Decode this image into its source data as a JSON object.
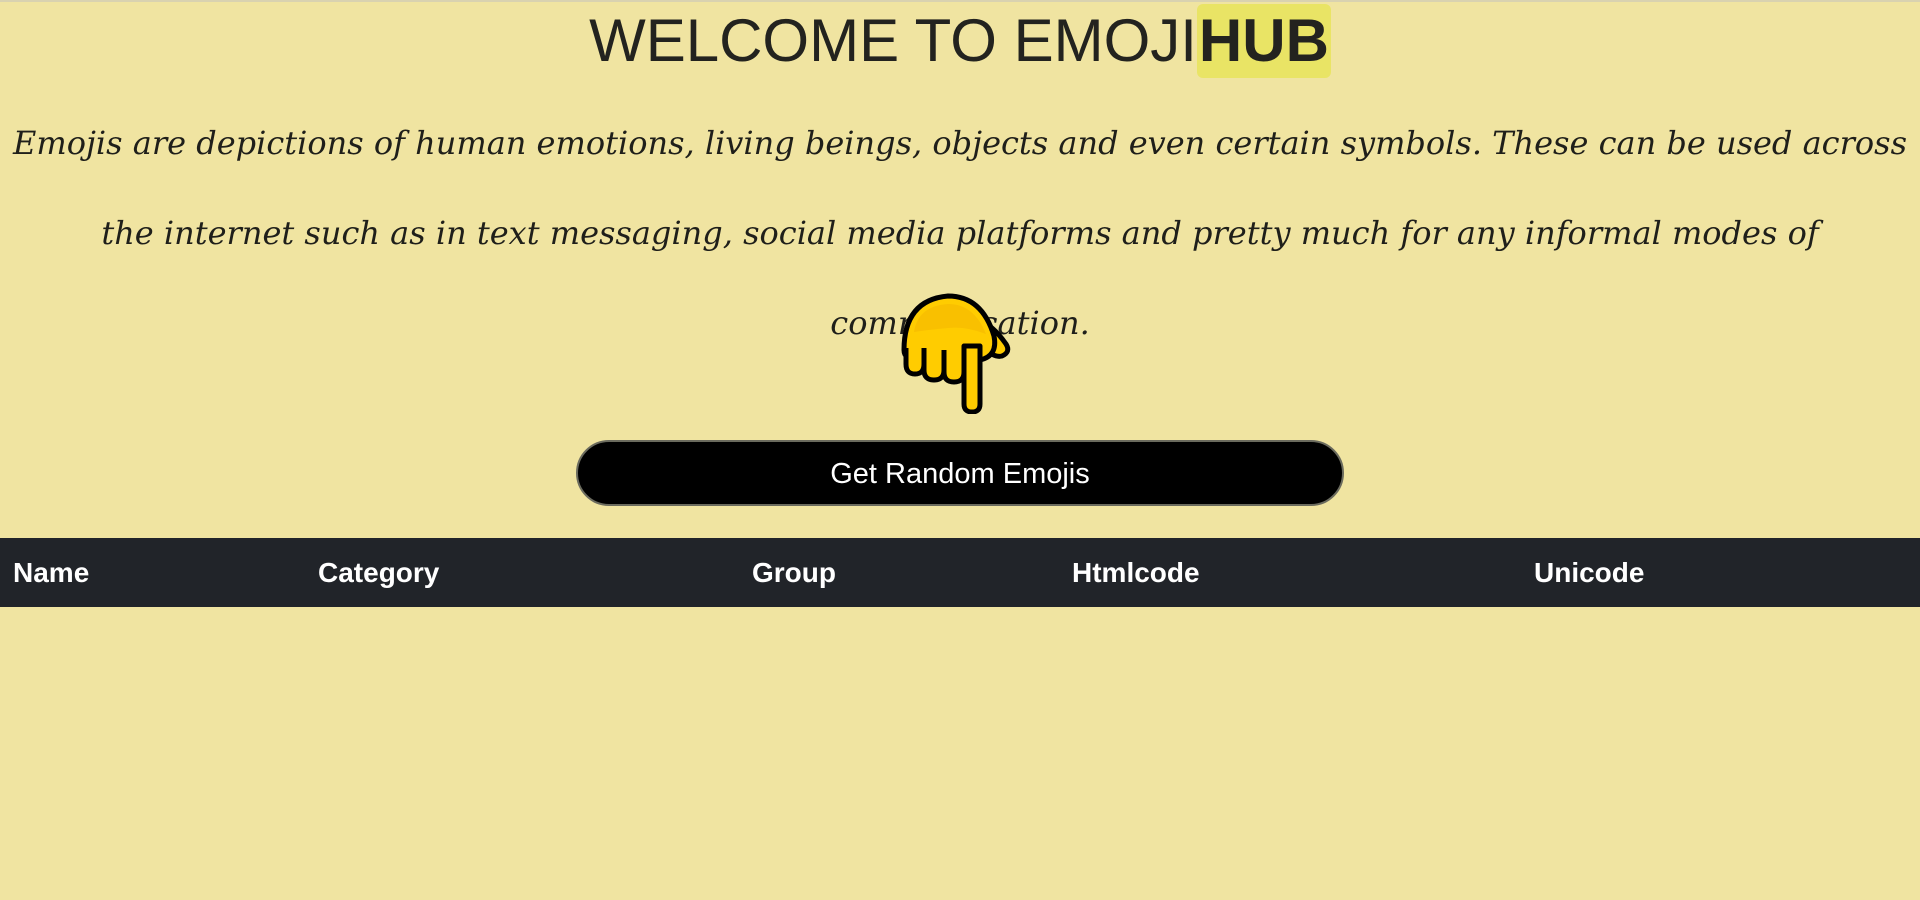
{
  "header": {
    "title_prefix": "WELCOME TO EMOJI",
    "title_highlight": "HUB",
    "description": "Emojis are depictions of human emotions, living beings, objects and even certain symbols. These can be used across the internet such as in text messaging, social media platforms and pretty much for any informal modes of communication."
  },
  "pointer": {
    "icon": "backhand-index-pointing-down-icon"
  },
  "actions": {
    "get_random_label": "Get Random Emojis"
  },
  "table": {
    "columns": [
      "Name",
      "Category",
      "Group",
      "Htmlcode",
      "Unicode"
    ],
    "rows": []
  },
  "colors": {
    "page_background": "#f0e4a1",
    "highlight": "#e9e465",
    "button_background": "#000000",
    "table_header_background": "#212429",
    "emoji_yellow": "#ffcc00"
  }
}
